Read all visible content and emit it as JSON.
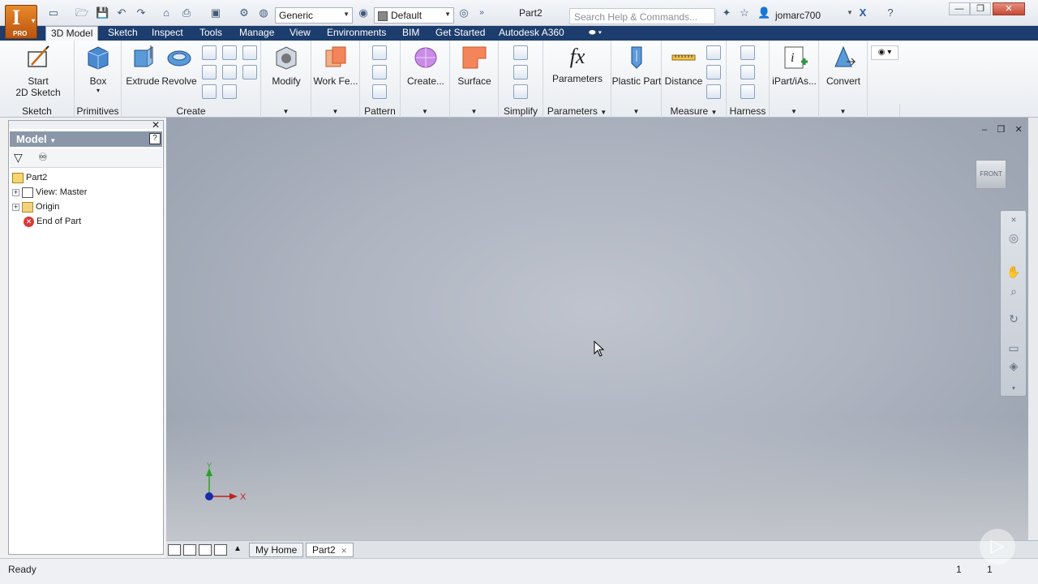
{
  "app": {
    "logo_letter": "I",
    "logo_edition": "PRO",
    "document_title": "Part2"
  },
  "qat": {
    "material": "Generic",
    "appearance": "Default"
  },
  "search": {
    "placeholder": "Search Help & Commands..."
  },
  "user": {
    "name": "jomarc700"
  },
  "tabs": [
    "3D Model",
    "Sketch",
    "Inspect",
    "Tools",
    "Manage",
    "View",
    "Environments",
    "BIM",
    "Get Started",
    "Autodesk A360"
  ],
  "ribbon": {
    "sketch": {
      "label": "Start\n2D Sketch",
      "label1": "Start",
      "label2": "2D Sketch",
      "group": "Sketch"
    },
    "primitives": {
      "label": "Box",
      "group": "Primitives"
    },
    "create": {
      "extrude": "Extrude",
      "revolve": "Revolve",
      "group": "Create"
    },
    "modify": {
      "label": "Modify"
    },
    "workfeatures": {
      "label": "Work Fe..."
    },
    "pattern": {
      "group": "Pattern"
    },
    "createform": {
      "label": "Create..."
    },
    "surface": {
      "label": "Surface"
    },
    "simplify": {
      "group": "Simplify"
    },
    "parameters": {
      "label": "Parameters",
      "group": "Parameters",
      "icon_text": "fx"
    },
    "plastic": {
      "label": "Plastic Part"
    },
    "measure": {
      "label": "Distance",
      "group": "Measure"
    },
    "harness": {
      "group": "Harness"
    },
    "ipart": {
      "label": "iPart/iAs..."
    },
    "convert": {
      "label": "Convert"
    }
  },
  "browser": {
    "title": "Model",
    "items": [
      {
        "label": "Part2",
        "icon": "part-icon"
      },
      {
        "label": "View: Master",
        "icon": "view-icon"
      },
      {
        "label": "Origin",
        "icon": "folder-icon"
      },
      {
        "label": "End of Part",
        "icon": "end-of-part-icon"
      }
    ]
  },
  "viewport": {
    "viewcube_label": "FRONT",
    "axis_x": "X",
    "axis_y": "Y"
  },
  "doc_tabs": {
    "home": "My Home",
    "part": "Part2"
  },
  "status": {
    "text": "Ready",
    "count1": "1",
    "count2": "1"
  }
}
